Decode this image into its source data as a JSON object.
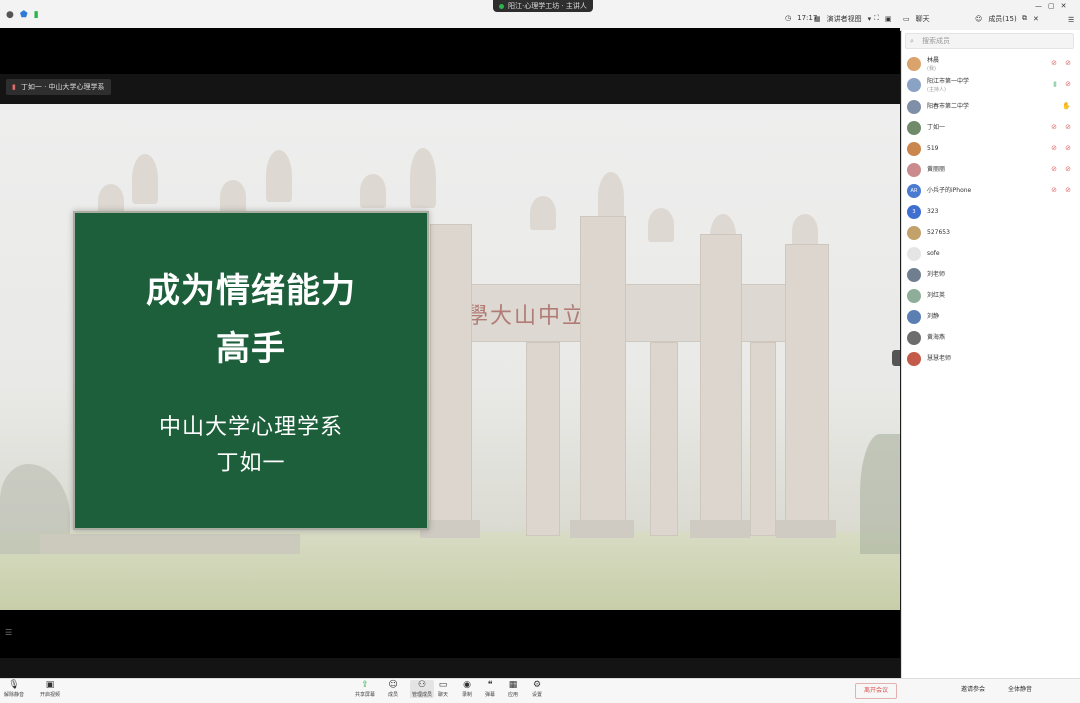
{
  "top": {
    "left_icons": [
      "info-icon",
      "shield-icon",
      "signal-icon"
    ],
    "meeting_title": "阳江·心理学工坊 · 主讲人",
    "time": "17:17",
    "view_label": "演讲者视图",
    "chat_tab": "聊天",
    "members_tab": "成员(15)"
  },
  "stage": {
    "name_tag": "丁如一 · 中山大学心理学系",
    "slide": {
      "gate_text": "學大山中立國",
      "title_line1": "成为情绪能力",
      "title_line2": "高手",
      "subtitle_line1": "中山大学心理学系",
      "subtitle_line2": "丁如一"
    }
  },
  "sidebar": {
    "search_placeholder": "搜索成员",
    "members": [
      {
        "name": "林晨",
        "sub": "(我)",
        "color": "#d9a36b"
      },
      {
        "name": "阳江市第一中学",
        "sub": "(主持人)",
        "color": "#8aa2c4"
      },
      {
        "name": "阳春市第二中学",
        "sub": "",
        "color": "#7f8fa8"
      },
      {
        "name": "丁如一",
        "sub": "",
        "color": "#6f8b6a"
      },
      {
        "name": "519",
        "sub": "",
        "color": "#c9874e"
      },
      {
        "name": "黄丽丽",
        "sub": "",
        "color": "#c98b8b"
      },
      {
        "name": "小兵子的iPhone",
        "sub": "",
        "color": "#4a7bd0",
        "initials": "AR"
      },
      {
        "name": "323",
        "sub": "",
        "color": "#3f6fd1",
        "initials": "3"
      },
      {
        "name": "527653",
        "sub": "",
        "color": "#c2a16a"
      },
      {
        "name": "sofe",
        "sub": "",
        "color": "#e5e5e5"
      },
      {
        "name": "刘老师",
        "sub": "",
        "color": "#6f7f8f"
      },
      {
        "name": "刘红英",
        "sub": "",
        "color": "#8fae9a"
      },
      {
        "name": "刘静",
        "sub": "",
        "color": "#5b7fb3"
      },
      {
        "name": "黄海燕",
        "sub": "",
        "color": "#6d6d6d"
      },
      {
        "name": "慧慧老师",
        "sub": "",
        "color": "#c45a4a"
      }
    ],
    "invite_label": "邀请参会",
    "mute_label": "全体静音"
  },
  "bottom": {
    "left": [
      {
        "label": "解除静音",
        "icon": "mic-icon"
      },
      {
        "label": "开启视频",
        "icon": "camera-icon"
      }
    ],
    "center": [
      {
        "label": "共享屏幕",
        "icon": "share-icon"
      },
      {
        "label": "成员",
        "icon": "members-icon"
      },
      {
        "label": "管理成员",
        "icon": "manage-icon"
      },
      {
        "label": "聊天",
        "icon": "chat-icon"
      },
      {
        "label": "录制",
        "icon": "record-icon"
      },
      {
        "label": "弹幕",
        "icon": "comment-icon"
      },
      {
        "label": "应用",
        "icon": "apps-icon"
      },
      {
        "label": "设置",
        "icon": "settings-icon"
      }
    ],
    "end_label": "离开会议"
  }
}
